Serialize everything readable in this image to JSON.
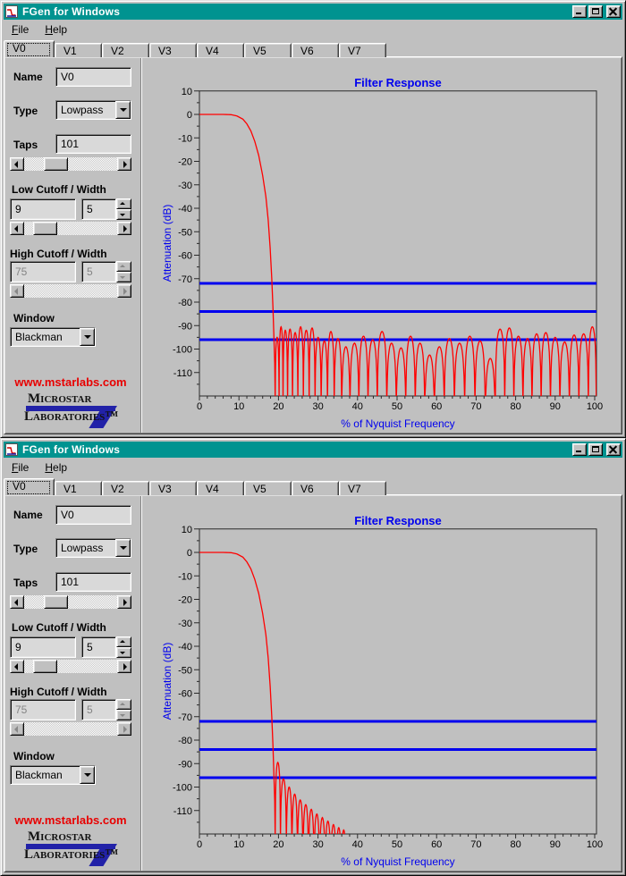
{
  "app": {
    "window_title": "FGen for Windows",
    "menu": [
      {
        "label": "File"
      },
      {
        "label": "Help"
      }
    ],
    "tabs": [
      "V0",
      "V1",
      "V2",
      "V3",
      "V4",
      "V5",
      "V6",
      "V7"
    ],
    "active_tab_index": 0,
    "titlebar_buttons": [
      "minimize",
      "maximize",
      "close"
    ]
  },
  "panel": {
    "name_label": "Name",
    "name_value": "V0",
    "type_label": "Type",
    "type_value": "Lowpass",
    "taps_label": "Taps",
    "taps_value": "101",
    "low_label": "Low Cutoff / Width",
    "low_cutoff_value": "9",
    "low_width_value": "5",
    "high_label": "High Cutoff / Width",
    "high_cutoff_value": "75",
    "high_width_value": "5",
    "window_label": "Window",
    "window_value": "Blackman",
    "link_text": "www.mstarlabs.com",
    "logo_line1": "Microstar",
    "logo_line2": "Laboratories™"
  },
  "colors": {
    "titlebar": "#009390",
    "title_text": "#ffffff",
    "window_bg": "#c0c0c0",
    "chart_text": "#0000ee",
    "curve": "#ff0000",
    "ref_line": "#0000ee",
    "link": "#e80000",
    "logo_blue": "#2222a8"
  },
  "chart_data": [
    {
      "type": "line",
      "title": "Filter Response",
      "xlabel": "% of Nyquist Frequency",
      "ylabel": "Attenuation (dB)",
      "xlim": [
        0,
        100
      ],
      "ylim": [
        -120,
        10
      ],
      "x_major_step": 10,
      "x_minor_step": 2,
      "y_major_step": 10,
      "y_minor_step": 5,
      "grid": false,
      "legend": false,
      "ref_lines_db": [
        -72,
        -84,
        -96
      ],
      "series": [
        {
          "name": "designed-filter-response",
          "color": "#ff0000",
          "floor_db": -122,
          "passband": [
            [
              0,
              0
            ],
            [
              6,
              0
            ],
            [
              8,
              -0.1
            ],
            [
              9.5,
              -0.7
            ],
            [
              11,
              -2
            ],
            [
              12,
              -4
            ],
            [
              13,
              -7
            ],
            [
              14,
              -11.5
            ],
            [
              15,
              -17.5
            ],
            [
              16,
              -26
            ],
            [
              16.8,
              -35
            ],
            [
              17.4,
              -45
            ],
            [
              17.9,
              -57
            ],
            [
              18.3,
              -70
            ],
            [
              18.6,
              -82
            ],
            [
              18.85,
              -95
            ],
            [
              19.05,
              -106
            ]
          ],
          "stopband_lobes": [
            [
              19.7,
              -95
            ],
            [
              20.6,
              -90.5
            ],
            [
              21.7,
              -92
            ],
            [
              22.9,
              -91.5
            ],
            [
              24.2,
              -93
            ],
            [
              25.6,
              -90.5
            ],
            [
              27.0,
              -92
            ],
            [
              28.5,
              -91
            ],
            [
              30.0,
              -95
            ],
            [
              31.6,
              -96.5
            ],
            [
              33.2,
              -92.5
            ],
            [
              35.0,
              -95.5
            ],
            [
              37.0,
              -99
            ],
            [
              39.2,
              -97.5
            ],
            [
              41.5,
              -94.5
            ],
            [
              43.8,
              -96
            ],
            [
              46.2,
              -92.5
            ],
            [
              48.6,
              -97.5
            ],
            [
              51.0,
              -99.5
            ],
            [
              53.4,
              -94.5
            ],
            [
              55.8,
              -97.5
            ],
            [
              58.2,
              -102.5
            ],
            [
              60.7,
              -99
            ],
            [
              63.2,
              -95.5
            ],
            [
              65.8,
              -97.5
            ],
            [
              68.4,
              -94.5
            ],
            [
              71.0,
              -96.5
            ],
            [
              73.6,
              -104
            ],
            [
              76.1,
              -91.5
            ],
            [
              78.4,
              -91
            ],
            [
              80.7,
              -94.5
            ],
            [
              83.0,
              -95.5
            ],
            [
              85.3,
              -93.5
            ],
            [
              87.6,
              -93
            ],
            [
              90.0,
              -95
            ],
            [
              92.4,
              -97
            ],
            [
              94.8,
              -94
            ],
            [
              97.2,
              -93.5
            ],
            [
              99.6,
              -90.5
            ]
          ]
        }
      ]
    },
    {
      "type": "line",
      "title": "Filter Response",
      "xlabel": "% of Nyquist Frequency",
      "ylabel": "Attenuation (dB)",
      "xlim": [
        0,
        100
      ],
      "ylim": [
        -120,
        10
      ],
      "x_major_step": 10,
      "x_minor_step": 2,
      "y_major_step": 10,
      "y_minor_step": 5,
      "grid": false,
      "legend": false,
      "ref_lines_db": [
        -72,
        -84,
        -96
      ],
      "series": [
        {
          "name": "windowed-filter-response",
          "color": "#ff0000",
          "floor_db": -122,
          "passband": [
            [
              0,
              0
            ],
            [
              6,
              0
            ],
            [
              8,
              -0.1
            ],
            [
              9.5,
              -0.7
            ],
            [
              11,
              -2
            ],
            [
              12,
              -4
            ],
            [
              13,
              -7
            ],
            [
              14,
              -11.5
            ],
            [
              15,
              -17.5
            ],
            [
              16,
              -26
            ],
            [
              16.8,
              -35
            ],
            [
              17.4,
              -45
            ],
            [
              17.9,
              -57
            ],
            [
              18.3,
              -70
            ],
            [
              18.6,
              -82
            ],
            [
              18.85,
              -95
            ],
            [
              19.05,
              -106
            ]
          ],
          "stopband_lobes": [
            [
              19.7,
              -89.5
            ],
            [
              21.3,
              -96.5
            ],
            [
              22.7,
              -100
            ],
            [
              24.1,
              -103
            ],
            [
              25.5,
              -105.5
            ],
            [
              26.9,
              -107.5
            ],
            [
              28.3,
              -109.5
            ],
            [
              29.7,
              -111.5
            ],
            [
              31.1,
              -113
            ],
            [
              32.5,
              -114.5
            ],
            [
              33.9,
              -116
            ],
            [
              35.3,
              -117.3
            ],
            [
              36.5,
              -118.3
            ]
          ]
        }
      ]
    }
  ]
}
